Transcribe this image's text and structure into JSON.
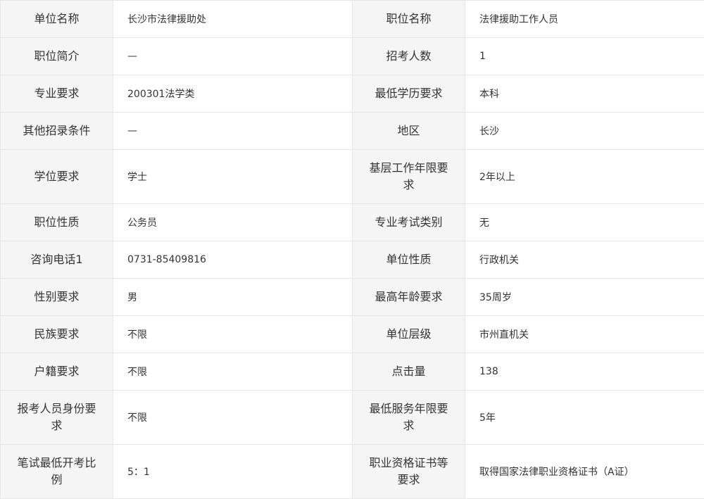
{
  "rows": [
    {
      "l1": "单位名称",
      "v1": "长沙市法律援助处",
      "l2": "职位名称",
      "v2": "法律援助工作人员"
    },
    {
      "l1": "职位简介",
      "v1": "—",
      "l2": "招考人数",
      "v2": "1"
    },
    {
      "l1": "专业要求",
      "v1": "200301法学类",
      "l2": "最低学历要求",
      "v2": "本科"
    },
    {
      "l1": "其他招录条件",
      "v1": "—",
      "l2": "地区",
      "v2": "长沙"
    },
    {
      "l1": "学位要求",
      "v1": "学士",
      "l2": "基层工作年限要求",
      "v2": "2年以上"
    },
    {
      "l1": "职位性质",
      "v1": "公务员",
      "l2": "专业考试类别",
      "v2": "无"
    },
    {
      "l1": "咨询电话1",
      "v1": "0731-85409816",
      "l2": "单位性质",
      "v2": "行政机关"
    },
    {
      "l1": "性别要求",
      "v1": "男",
      "l2": "最高年龄要求",
      "v2": "35周岁"
    },
    {
      "l1": "民族要求",
      "v1": "不限",
      "l2": "单位层级",
      "v2": "市州直机关"
    },
    {
      "l1": "户籍要求",
      "v1": "不限",
      "l2": "点击量",
      "v2": "138"
    },
    {
      "l1": "报考人员身份要求",
      "v1": "不限",
      "l2": "最低服务年限要求",
      "v2": "5年"
    },
    {
      "l1": "笔试最低开考比例",
      "v1": "5：1",
      "l2": "职业资格证书等要求",
      "v2": "取得国家法律职业资格证书（A证）"
    }
  ]
}
